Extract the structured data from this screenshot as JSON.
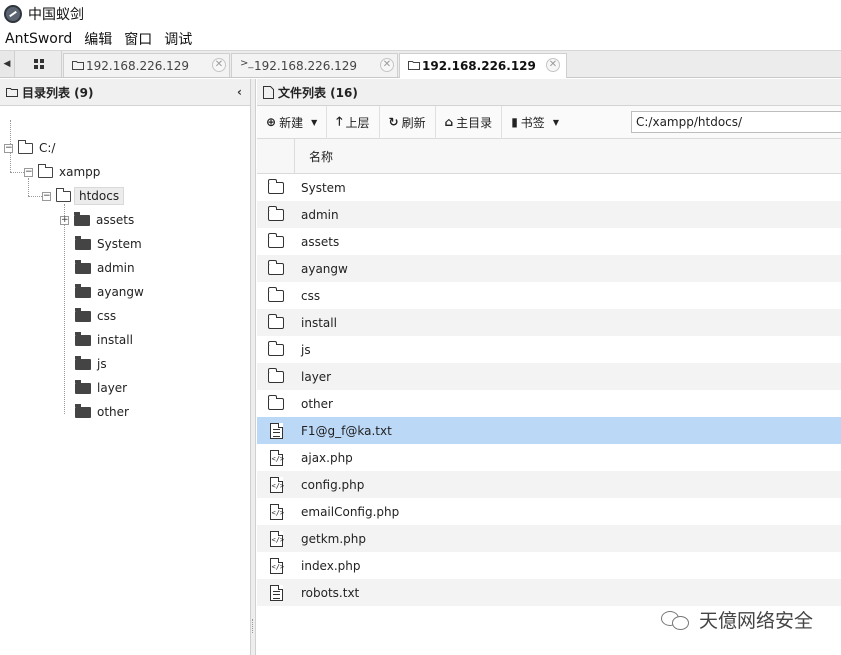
{
  "window": {
    "title": "中国蚁剑"
  },
  "menu": [
    "AntSword",
    "编辑",
    "窗口",
    "调试"
  ],
  "tabs": [
    {
      "label": "192.168.226.129",
      "icon": "folder-icon",
      "active": false
    },
    {
      "label": "192.168.226.129",
      "icon": "terminal-icon",
      "active": false
    },
    {
      "label": "192.168.226.129",
      "icon": "folder-icon",
      "active": true
    }
  ],
  "left_panel": {
    "title": "目录列表 (9)",
    "tree": {
      "root": "C:/",
      "xampp": "xampp",
      "htdocs": "htdocs",
      "children": [
        "assets",
        "System",
        "admin",
        "ayangw",
        "css",
        "install",
        "js",
        "layer",
        "other"
      ]
    }
  },
  "right_panel": {
    "title": "文件列表 (16)",
    "toolbar": {
      "new": "新建",
      "up": "上层",
      "refresh": "刷新",
      "home": "主目录",
      "bookmark": "书签",
      "path": "C:/xampp/htdocs/"
    },
    "column_name": "名称",
    "files": [
      {
        "name": "System",
        "type": "folder"
      },
      {
        "name": "admin",
        "type": "folder"
      },
      {
        "name": "assets",
        "type": "folder"
      },
      {
        "name": "ayangw",
        "type": "folder"
      },
      {
        "name": "css",
        "type": "folder"
      },
      {
        "name": "install",
        "type": "folder"
      },
      {
        "name": "js",
        "type": "folder"
      },
      {
        "name": "layer",
        "type": "folder"
      },
      {
        "name": "other",
        "type": "folder"
      },
      {
        "name": "F1@g_f@ka.txt",
        "type": "text",
        "selected": true
      },
      {
        "name": "ajax.php",
        "type": "code"
      },
      {
        "name": "config.php",
        "type": "code"
      },
      {
        "name": "emailConfig.php",
        "type": "code"
      },
      {
        "name": "getkm.php",
        "type": "code"
      },
      {
        "name": "index.php",
        "type": "code"
      },
      {
        "name": "robots.txt",
        "type": "text"
      }
    ]
  },
  "watermark": {
    "text": "天億网络安全"
  }
}
